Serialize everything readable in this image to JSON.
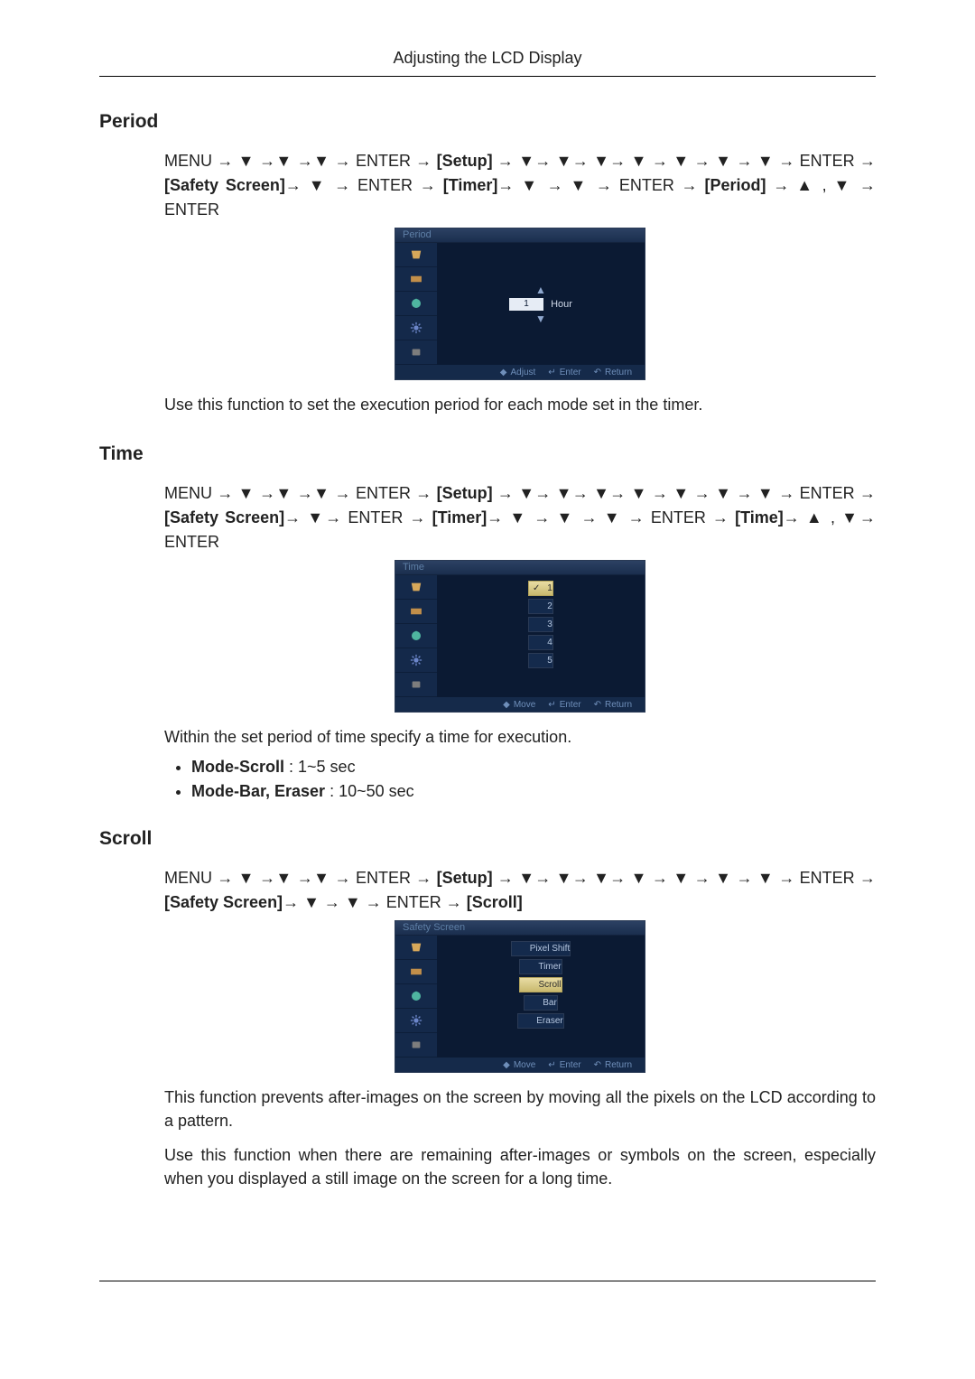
{
  "header": {
    "title": "Adjusting the LCD Display"
  },
  "sections": {
    "period": {
      "title": "Period",
      "nav_parts": [
        "MENU → ▼ →▼ →▼ → ENTER → ",
        "[Setup]",
        " → ▼→ ▼→ ▼→ ▼ → ▼ → ▼ → ▼ → ENTER → ",
        "[Safety Screen]",
        "→ ▼ → ENTER → ",
        "[Timer]",
        "→ ▼ → ▼ → ENTER → ",
        "[Period]",
        " → ▲ , ▼ → ENTER"
      ],
      "osd": {
        "title": "Period",
        "value": "1",
        "unit": "Hour",
        "hints": {
          "adjust": "Adjust",
          "enter": "Enter",
          "return": "Return"
        }
      },
      "desc": "Use this function to set the execution period for each mode set in the timer."
    },
    "time": {
      "title": "Time",
      "nav_parts": [
        "MENU → ▼ →▼ →▼ → ENTER → ",
        "[Setup]",
        " → ▼→ ▼→ ▼→ ▼ → ▼ → ▼ → ▼ → ENTER → ",
        "[Safety Screen]",
        "→ ▼→ ENTER → ",
        "[Timer]",
        "→ ▼ → ▼ → ▼ → ENTER → ",
        "[Time]",
        "→ ▲ , ▼→ ENTER"
      ],
      "osd": {
        "title": "Time",
        "options": [
          "1",
          "2",
          "3",
          "4",
          "5"
        ],
        "selected_index": 0,
        "hints": {
          "move": "Move",
          "enter": "Enter",
          "return": "Return"
        }
      },
      "desc": "Within the set period of time specify a time for execution.",
      "bullets": [
        {
          "bold": "Mode-Scroll",
          "rest": " : 1~5 sec"
        },
        {
          "bold": "Mode-Bar, Eraser",
          "rest": " : 10~50 sec"
        }
      ]
    },
    "scroll": {
      "title": "Scroll",
      "nav_parts": [
        "MENU → ▼ →▼ →▼ → ENTER → ",
        "[Setup]",
        " → ▼→ ▼→ ▼→ ▼ → ▼ → ▼ → ▼ → ENTER → ",
        "[Safety Screen]",
        "→ ▼ → ▼ → ENTER → ",
        "[Scroll]",
        ""
      ],
      "osd": {
        "title": "Safety Screen",
        "options": [
          "Pixel Shift",
          "Timer",
          "Scroll",
          "Bar",
          "Eraser"
        ],
        "selected_index": 2,
        "hints": {
          "move": "Move",
          "enter": "Enter",
          "return": "Return"
        }
      },
      "desc1": "This function prevents after-images on the screen by moving all the pixels on the LCD according to a pattern.",
      "desc2": "Use this function when there are remaining after-images or symbols on the screen, especially when you displayed a still image on the screen for a long time."
    }
  },
  "icons": {
    "sidebar_alt": [
      "picture-icon",
      "input-icon",
      "power-icon",
      "settings-icon",
      "mode-icon"
    ]
  },
  "glyphs": {
    "diamond": "◆",
    "enter_sym": "↵",
    "return_sym": "↶",
    "check": "✓",
    "bullet": "•"
  }
}
